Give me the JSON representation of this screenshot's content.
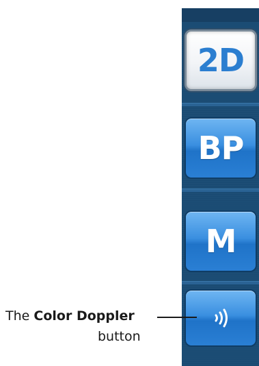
{
  "mode_bar": {
    "buttons": [
      {
        "label": "2D",
        "selected": true
      },
      {
        "label": "BP",
        "selected": false
      },
      {
        "label": "M",
        "selected": false
      },
      {
        "icon": "color-doppler-icon",
        "selected": false
      }
    ],
    "colors": {
      "panel": "#1a4b73",
      "button_blue": "#3a8fe0",
      "selected_text": "#2b7ed0"
    }
  },
  "callout": {
    "prefix": "The",
    "emphasis": "Color Doppler",
    "suffix": "button"
  }
}
